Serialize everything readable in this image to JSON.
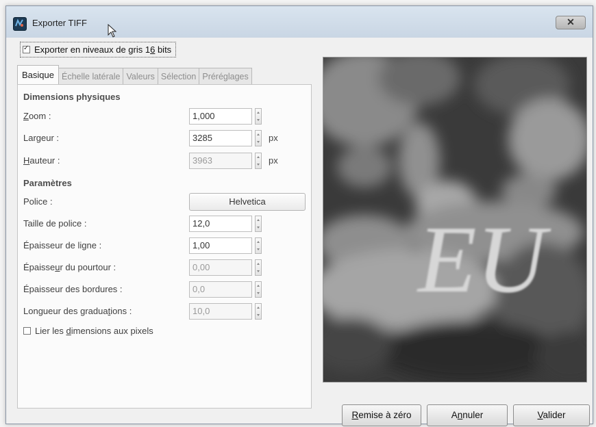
{
  "window": {
    "title": "Exporter TIFF",
    "close_glyph": "✕"
  },
  "gray16": {
    "checked": true,
    "label_pre": "Exporter en niveaux de gris 1",
    "label_mn": "6",
    "label_post": " bits"
  },
  "tabs": [
    {
      "label": "Basique",
      "active": true
    },
    {
      "label": "Échelle latérale",
      "active": false
    },
    {
      "label": "Valeurs",
      "active": false
    },
    {
      "label": "Sélection",
      "active": false
    },
    {
      "label": "Préréglages",
      "active": false
    }
  ],
  "physical": {
    "title": "Dimensions physiques",
    "zoom_mn": "Z",
    "zoom_rest": "oom :",
    "zoom_value": "1,000",
    "width_label": "Largeur :",
    "width_value": "3285",
    "width_unit": "px",
    "height_mn": "H",
    "height_rest": "auteur :",
    "height_value": "3963",
    "height_unit": "px"
  },
  "params": {
    "title": "Paramètres",
    "font_label": "Police :",
    "font_value": "Helvetica",
    "font_size_label": "Taille de police :",
    "font_size_value": "12,0",
    "line_width_label": "Épaisseur de ligne :",
    "line_width_value": "1,00",
    "outline_pre": "Épaisse",
    "outline_mn": "u",
    "outline_post": "r du pourtour :",
    "outline_value": "0,00",
    "border_label": "Épaisseur des bordures :",
    "border_value": "0,0",
    "tick_pre": "Longueur des gradua",
    "tick_mn": "t",
    "tick_post": "ions :",
    "tick_value": "10,0",
    "link_checked": false,
    "link_pre": "Lier les ",
    "link_mn": "d",
    "link_post": "imensions aux pixels"
  },
  "preview": {
    "overlay_text": "EU"
  },
  "buttons": {
    "reset_mn": "R",
    "reset_rest": "emise à zéro",
    "cancel_pre": "A",
    "cancel_mn": "n",
    "cancel_post": "nuler",
    "ok_mn": "V",
    "ok_rest": "alider"
  },
  "colors": {
    "title_bar": "#c9d6e4",
    "panel_bg": "#fbfbfb",
    "disabled_text": "#9a9a9a"
  }
}
